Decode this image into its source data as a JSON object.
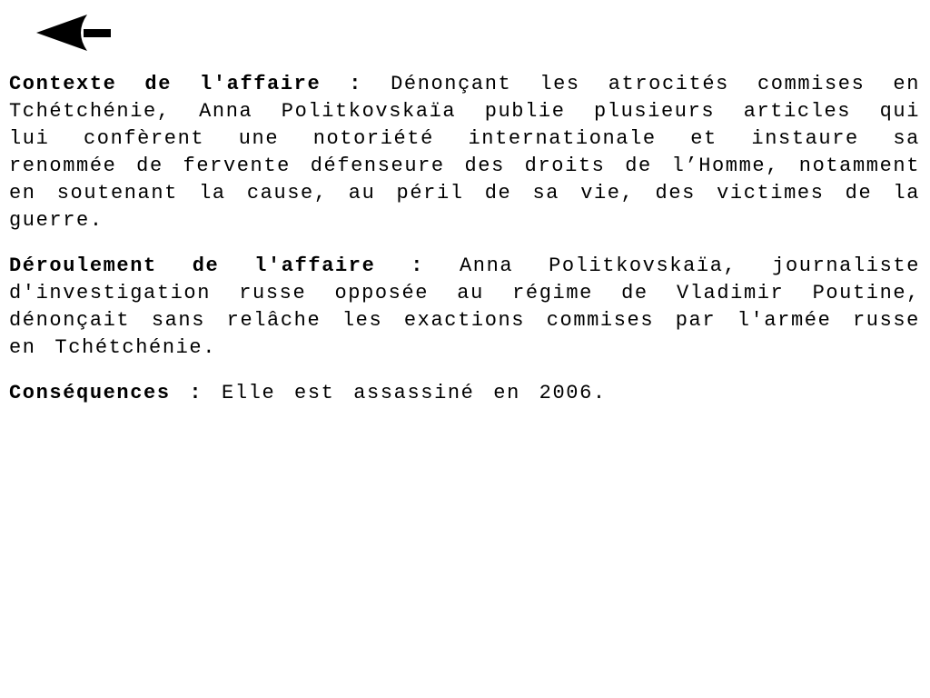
{
  "nav": {
    "back_icon": "arrow-left-icon"
  },
  "sections": [
    {
      "heading": "Contexte de l'affaire :",
      "text": " Dénonçant les atrocités commises en Tchétchénie, Anna Politkovskaïa publie plusieurs articles qui lui confèrent une notoriété internationale et instaure sa renommée de fervente défenseure des droits de l’Homme, notamment en soutenant la cause, au péril de sa vie, des victimes de la guerre."
    },
    {
      "heading": "Déroulement de l'affaire :",
      "text": " Anna Politkovskaïa, journaliste d'investigation russe opposée au régime de Vladimir Poutine, dénonçait sans relâche les exactions commises par l'armée russe en Tchétchénie."
    },
    {
      "heading": "Conséquences :",
      "text": " Elle est assassiné en 2006."
    }
  ]
}
